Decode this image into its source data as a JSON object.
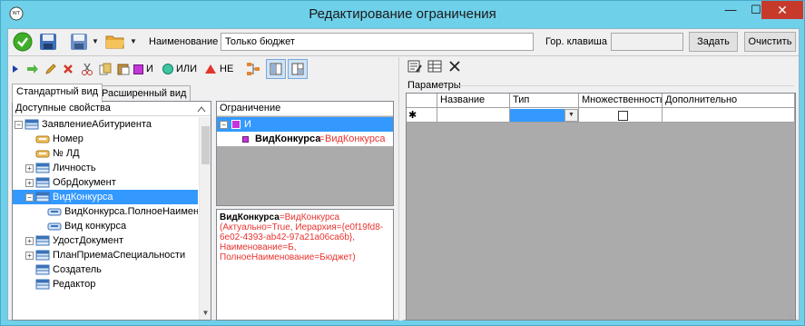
{
  "window": {
    "title": "Редактирование  ограничения",
    "minimize": "—",
    "maximize": "☐",
    "close": "✕"
  },
  "toolbar": {
    "name_label": "Наименование",
    "name_value": "Только бюджет",
    "hotkey_label": "Гор. клавиша",
    "hotkey_value": "",
    "set_button": "Задать",
    "clear_button": "Очистить"
  },
  "condition_toolbar": {
    "and_label": "И",
    "or_label": "ИЛИ",
    "not_label": "НЕ"
  },
  "tabs": [
    {
      "label": "Стандартный вид",
      "active": true
    },
    {
      "label": "Расширенный вид",
      "active": false
    }
  ],
  "properties": {
    "header": "Доступные свойства",
    "items": [
      {
        "label": "ЗаявлениеАбитуриента",
        "level": 0,
        "expander": "−",
        "icon": "table-icon"
      },
      {
        "label": "Номер",
        "level": 1,
        "expander": "",
        "icon": "field-icon"
      },
      {
        "label": "№ ЛД",
        "level": 1,
        "expander": "",
        "icon": "field-icon"
      },
      {
        "label": "Личность",
        "level": 1,
        "expander": "+",
        "icon": "table-icon"
      },
      {
        "label": "ОбрДокумент",
        "level": 1,
        "expander": "+",
        "icon": "table-icon"
      },
      {
        "label": "ВидКонкурса",
        "level": 1,
        "expander": "−",
        "icon": "table-icon",
        "selected": true
      },
      {
        "label": "ВидКонкурса.ПолноеНаименова",
        "level": 2,
        "expander": "",
        "icon": "field-link-icon"
      },
      {
        "label": "Вид конкурса",
        "level": 2,
        "expander": "",
        "icon": "field-link-icon"
      },
      {
        "label": "УдостДокумент",
        "level": 1,
        "expander": "+",
        "icon": "table-icon"
      },
      {
        "label": "ПланПриемаСпециальности",
        "level": 1,
        "expander": "+",
        "icon": "table-icon"
      },
      {
        "label": "Создатель",
        "level": 1,
        "expander": "",
        "icon": "table-icon"
      },
      {
        "label": "Редактор",
        "level": 1,
        "expander": "",
        "icon": "table-icon"
      }
    ]
  },
  "conditions": {
    "header": "Ограничение",
    "root_label": "И",
    "item_prop": "ВидКонкурса",
    "item_eq": "=",
    "item_value": "ВидКонкурса"
  },
  "description": {
    "prop": "ВидКонкурса",
    "eq": "=",
    "value": "ВидКонкурса",
    "line2": "(Актуально=True, Иерархия={e0f19fd8-",
    "line3": "6e02-4393-ab42-97a21a06ca6b},",
    "line4": "Наименование=Б,",
    "line5": "ПолноеНаименование=Бюджет)"
  },
  "parameters": {
    "label": "Параметры",
    "columns": [
      "Название",
      "Тип",
      "Множественность",
      "Дополнительно"
    ],
    "new_row_marker": "✱"
  },
  "colors": {
    "window_frame": "#6fd0ea",
    "selection": "#3399ff",
    "value_red": "#e8332f",
    "close_red": "#c7392b"
  }
}
